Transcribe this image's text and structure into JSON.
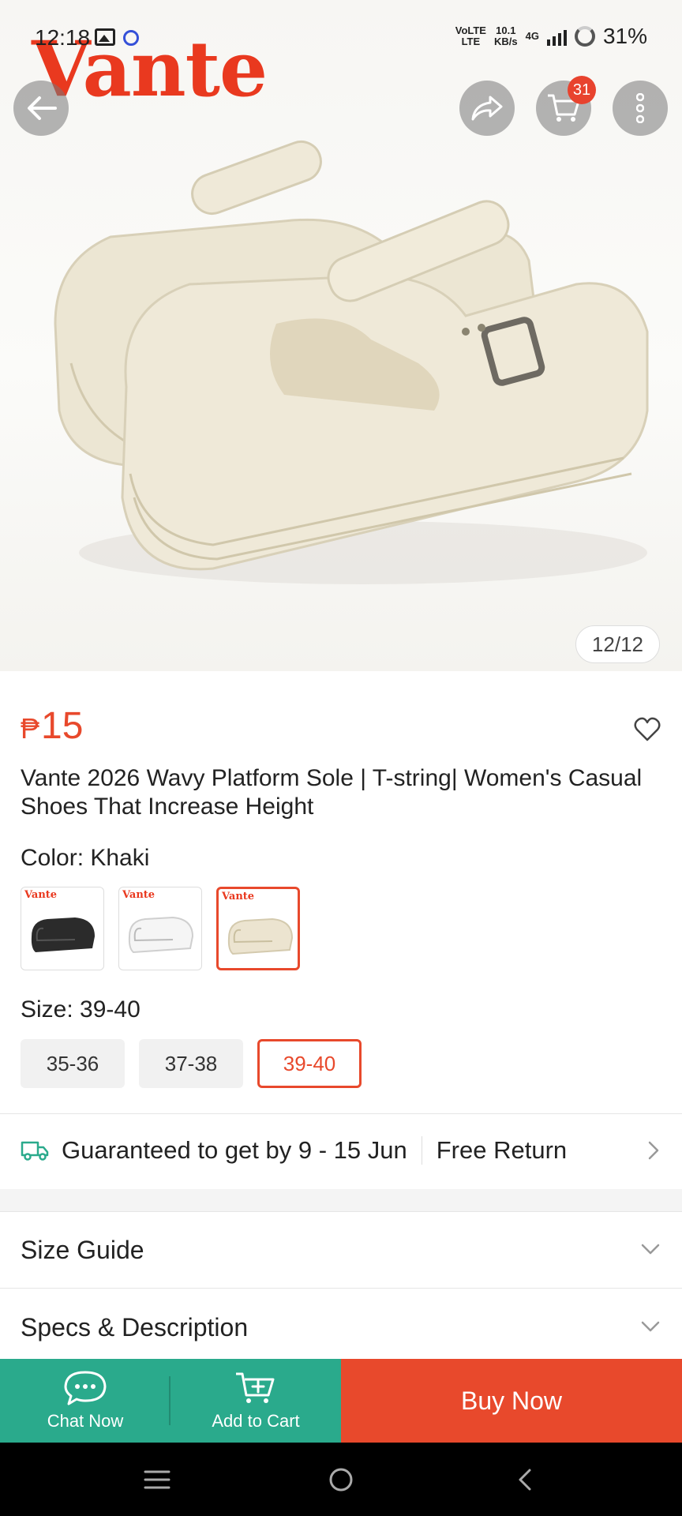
{
  "status_bar": {
    "time": "12:18",
    "network_type": "VoLTE",
    "network_label": "LTE",
    "speed_value": "10.1",
    "speed_unit": "KB/s",
    "cellular": "4G",
    "battery": "31%"
  },
  "header": {
    "brand": "Vante",
    "cart_count": "31",
    "image_counter": "12/12"
  },
  "product": {
    "currency_symbol": "₱",
    "price": "15",
    "title": "Vante 2026 Wavy Platform Sole | T-string| Women's Casual Shoes That Increase Height",
    "color_label": "Color: Khaki",
    "color_swatches": [
      {
        "brand": "Vante",
        "color": "#2b2b2b",
        "selected": false
      },
      {
        "brand": "Vante",
        "color": "#f3f3f3",
        "selected": false
      },
      {
        "brand": "Vante",
        "color": "#ece4d0",
        "selected": true
      }
    ],
    "size_label": "Size: 39-40",
    "sizes": [
      {
        "label": "35-36",
        "selected": false
      },
      {
        "label": "37-38",
        "selected": false
      },
      {
        "label": "39-40",
        "selected": true
      }
    ]
  },
  "delivery": {
    "guarantee_text": "Guaranteed to get by 9 - 15 Jun",
    "return_text": "Free Return"
  },
  "accordions": {
    "size_guide": "Size Guide",
    "specs": "Specs & Description"
  },
  "actions": {
    "chat": "Chat Now",
    "add_to_cart": "Add to Cart",
    "buy_now": "Buy Now"
  },
  "colors": {
    "accent": "#e8492c",
    "teal": "#2aaa8c",
    "brand_red": "#e9391f"
  }
}
